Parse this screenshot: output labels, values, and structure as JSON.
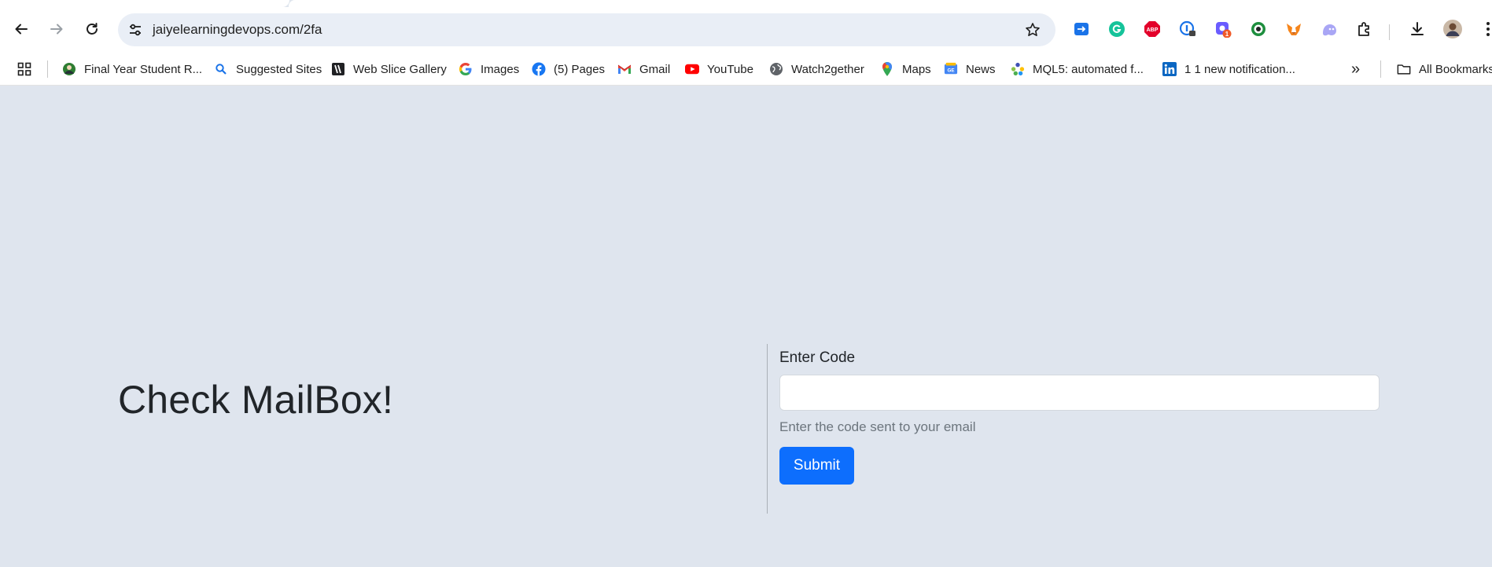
{
  "browser": {
    "url": "jaiyelearningdevops.com/2fa",
    "extension_badge": "1"
  },
  "bookmarks": {
    "items": [
      {
        "label": "Final Year Student R...",
        "icon": "avatar-favicon-icon"
      },
      {
        "label": "Suggested Sites",
        "icon": "search-favicon-icon"
      },
      {
        "label": "Web Slice Gallery",
        "icon": "web-slice-icon"
      },
      {
        "label": "Images",
        "icon": "google-icon"
      },
      {
        "label": "(5) Pages",
        "icon": "facebook-icon"
      },
      {
        "label": "Gmail",
        "icon": "gmail-icon"
      },
      {
        "label": "YouTube",
        "icon": "youtube-icon"
      },
      {
        "label": "Watch2gether",
        "icon": "globe-icon"
      },
      {
        "label": "Maps",
        "icon": "maps-pin-icon"
      },
      {
        "label": "News",
        "icon": "google-news-icon"
      },
      {
        "label": "MQL5: automated f...",
        "icon": "mql5-icon"
      },
      {
        "label": "1 1 new notification...",
        "icon": "linkedin-icon"
      }
    ],
    "more_label": "»",
    "all_bookmarks_label": "All Bookmarks"
  },
  "page": {
    "headline": "Check MailBox!",
    "code_label": "Enter Code",
    "code_value": "",
    "help_text": "Enter the code sent to your email",
    "submit_label": "Submit"
  },
  "colors": {
    "page_background": "#dfe5ee",
    "primary_button": "#0d6efd",
    "omnibox": "#e9eef6"
  }
}
